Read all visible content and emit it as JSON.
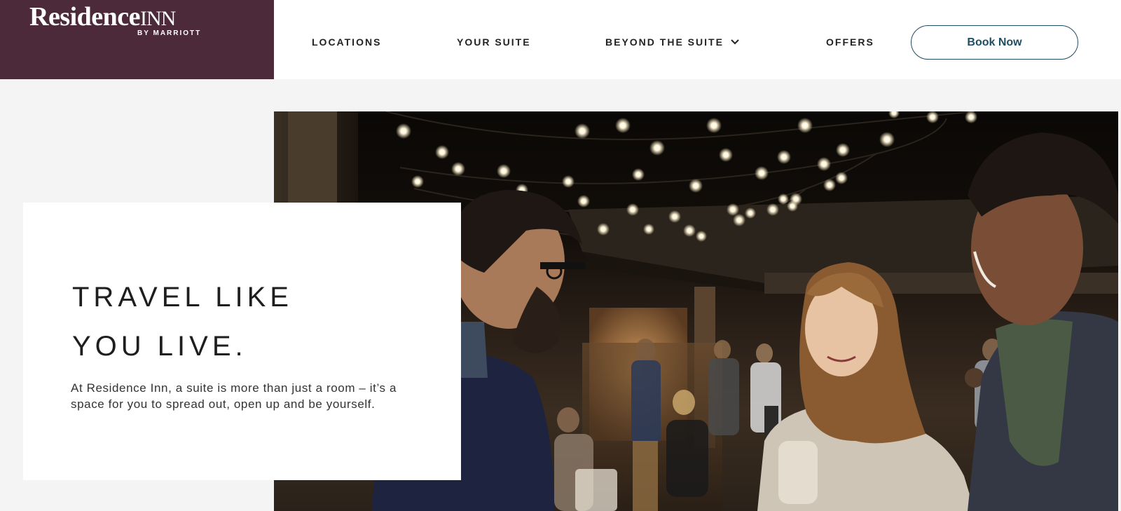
{
  "brand": {
    "name": "Residence",
    "name_suffix": "INN",
    "sub": "BY MARRIOTT",
    "color": "#4d2a39"
  },
  "nav": {
    "items": [
      {
        "label": "LOCATIONS"
      },
      {
        "label": "YOUR SUITE"
      },
      {
        "label": "BEYOND THE SUITE"
      },
      {
        "label": "OFFERS"
      }
    ],
    "book_label": "Book Now",
    "book_color": "#1f4e63"
  },
  "hero": {
    "title_line1": "TRAVEL LIKE",
    "title_line2": "YOU LIVE.",
    "body": "At Residence Inn, a suite is more than just a room – it’s a space for you to spread out, open up and be yourself."
  }
}
